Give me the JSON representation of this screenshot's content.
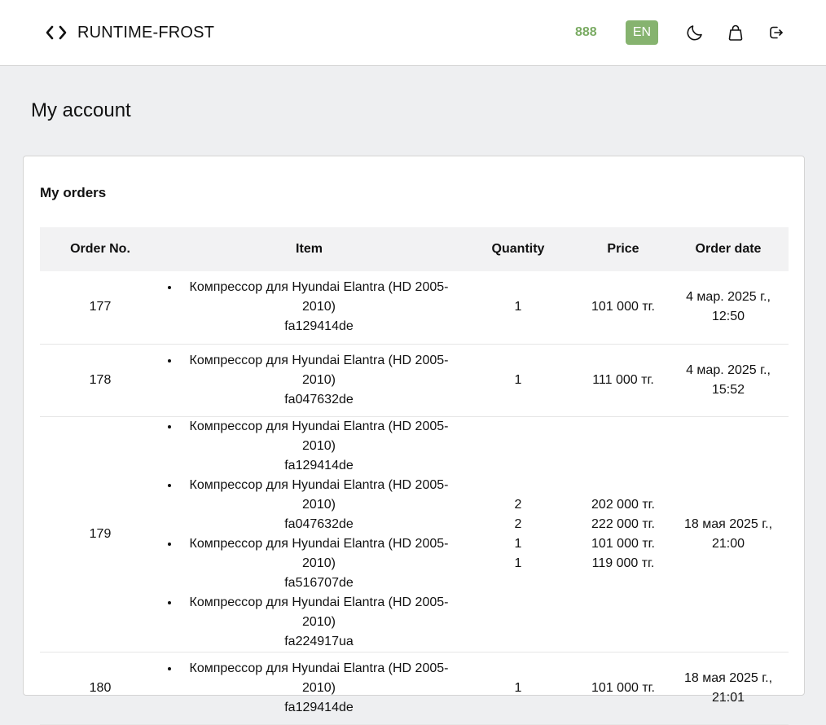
{
  "header": {
    "brand": "RUNTIME-FROST",
    "phone": "888",
    "lang": "EN",
    "icons": [
      "code-icon",
      "moon-icon",
      "bag-icon",
      "logout-icon"
    ]
  },
  "page": {
    "title": "My account"
  },
  "orders": {
    "title": "My orders",
    "columns": [
      "Order No.",
      "Item",
      "Quantity",
      "Price",
      "Order date"
    ],
    "rows": [
      {
        "no": "177",
        "items": [
          {
            "name": "Компрессор для Hyundai Elantra (HD 2005-2010)",
            "code": "fa129414de"
          }
        ],
        "qty": [
          "1"
        ],
        "price": [
          "101 000 тг."
        ],
        "date": [
          "4 мар. 2025 г.,",
          "12:50"
        ]
      },
      {
        "no": "178",
        "items": [
          {
            "name": "Компрессор для Hyundai Elantra (HD 2005-2010)",
            "code": "fa047632de"
          }
        ],
        "qty": [
          "1"
        ],
        "price": [
          "111 000 тг."
        ],
        "date": [
          "4 мар. 2025 г.,",
          "15:52"
        ]
      },
      {
        "no": "179",
        "items": [
          {
            "name": "Компрессор для Hyundai Elantra (HD 2005-2010)",
            "code": "fa129414de"
          },
          {
            "name": "Компрессор для Hyundai Elantra (HD 2005-2010)",
            "code": "fa047632de"
          },
          {
            "name": "Компрессор для Hyundai Elantra (HD 2005-2010)",
            "code": "fa516707de"
          },
          {
            "name": "Компрессор для Hyundai Elantra (HD 2005-2010)",
            "code": "fa224917ua"
          }
        ],
        "qty": [
          "2",
          "2",
          "1",
          "1"
        ],
        "price": [
          "202 000 тг.",
          "222 000 тг.",
          "101 000 тг.",
          "119 000 тг."
        ],
        "date": [
          "18 мая 2025 г.,",
          "21:00"
        ]
      },
      {
        "no": "180",
        "items": [
          {
            "name": "Компрессор для Hyundai Elantra (HD 2005-2010)",
            "code": "fa129414de"
          }
        ],
        "qty": [
          "1"
        ],
        "price": [
          "101 000 тг."
        ],
        "date": [
          "18 мая 2025 г.,",
          "21:01"
        ]
      }
    ]
  }
}
